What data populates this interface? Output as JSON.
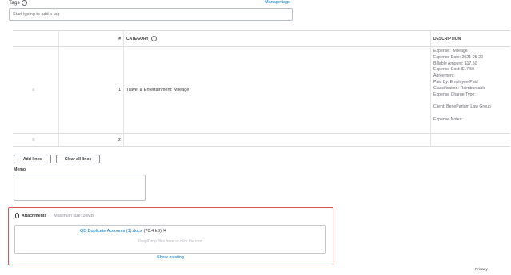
{
  "tags": {
    "label": "Tags",
    "help_glyph": "?",
    "manage_link": "Manage tags",
    "input_placeholder": "Start typing to add a tag"
  },
  "table": {
    "headers": {
      "num": "#",
      "category": "CATEGORY",
      "description": "DESCRIPTION"
    },
    "drag_glyph": "≡",
    "rows": [
      {
        "num": "1",
        "category": "Travel & Entertainment: Mileage",
        "description": "Expense:  Mileage\nExpense Date: 2021-05-20\nBillable Amount: $17.50\nExpense Cost: $17.50\nAgreement:\nPaid By: Employee Paid\nClassification: Reimbursable\nExpense Charge Type:\n\nClient: BenePartum Law Group\n\nExpense Notes:"
      },
      {
        "num": "2",
        "category": "",
        "description": ""
      }
    ]
  },
  "buttons": {
    "add_lines": "Add lines",
    "clear_all_lines": "Clear all lines"
  },
  "memo": {
    "label": "Memo"
  },
  "attachments": {
    "title": "Attachments",
    "max_size": "Maximum size: 20MB",
    "file_name": "QB Duplicate Accounts (1).docx",
    "file_size": "(70.4 kB)",
    "remove_glyph": "×",
    "drop_hint": "Drag/Drop files here or click the icon",
    "show_existing": "Show existing",
    "frame_color": "#d9534f"
  },
  "footer": {
    "privacy": "Privacy"
  },
  "colors": {
    "link": "#0077c5",
    "text": "#393a3d",
    "muted": "#8d9096",
    "highlight_border": "#d9534f"
  }
}
